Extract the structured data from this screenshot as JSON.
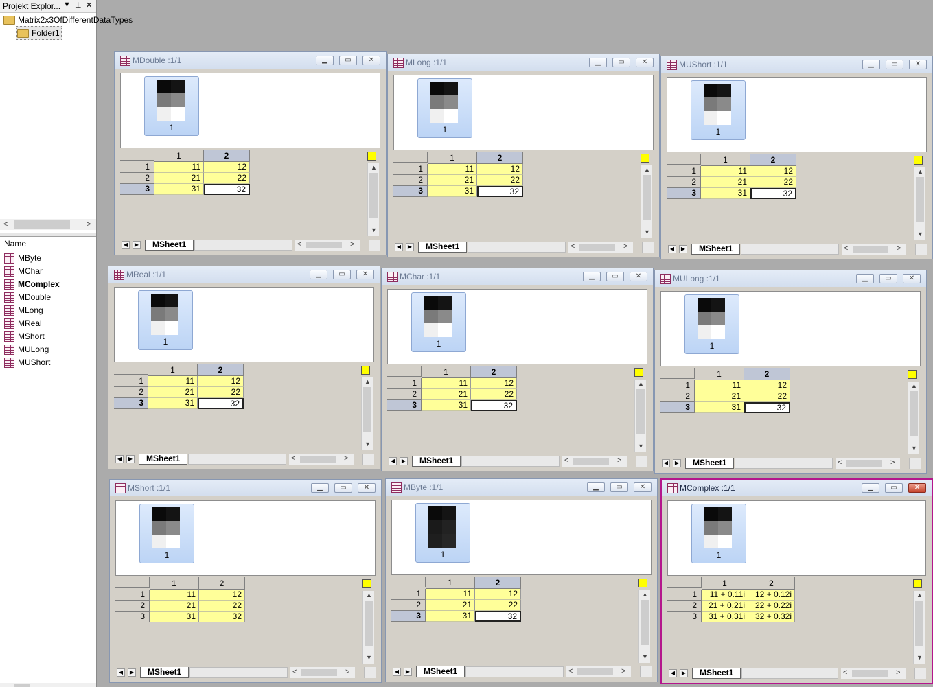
{
  "explorer": {
    "title": "Projekt Explor...",
    "pin": "▼",
    "dock": "⊥",
    "close": "✕",
    "tree": [
      {
        "label": "Matrix2x3OfDifferentDataTypes"
      },
      {
        "label": "Folder1"
      }
    ],
    "list_header": "Name",
    "items": [
      {
        "label": "MByte"
      },
      {
        "label": "MChar"
      },
      {
        "label": "MComplex"
      },
      {
        "label": "MDouble"
      },
      {
        "label": "MLong"
      },
      {
        "label": "MReal"
      },
      {
        "label": "MShort"
      },
      {
        "label": "MULong"
      },
      {
        "label": "MUShort"
      }
    ]
  },
  "colors": {
    "accent_active": "#b4168c",
    "cell_yellow": "#ffff99",
    "window_bg": "#d4d0c8"
  },
  "windows": [
    {
      "title": "MDouble :1/1",
      "thumb_label": "1",
      "columns": [
        "1",
        "2"
      ],
      "rows": [
        [
          "1",
          "11",
          "12"
        ],
        [
          "2",
          "21",
          "22"
        ],
        [
          "3",
          "31",
          "32"
        ]
      ],
      "sheet": "MSheet1"
    },
    {
      "title": "MLong :1/1",
      "thumb_label": "1",
      "columns": [
        "1",
        "2"
      ],
      "rows": [
        [
          "1",
          "11",
          "12"
        ],
        [
          "2",
          "21",
          "22"
        ],
        [
          "3",
          "31",
          "32"
        ]
      ],
      "sheet": "MSheet1"
    },
    {
      "title": "MUShort :1/1",
      "thumb_label": "1",
      "columns": [
        "1",
        "2"
      ],
      "rows": [
        [
          "1",
          "11",
          "12"
        ],
        [
          "2",
          "21",
          "22"
        ],
        [
          "3",
          "31",
          "32"
        ]
      ],
      "sheet": "MSheet1"
    },
    {
      "title": "MReal :1/1",
      "thumb_label": "1",
      "columns": [
        "1",
        "2"
      ],
      "rows": [
        [
          "1",
          "11",
          "12"
        ],
        [
          "2",
          "21",
          "22"
        ],
        [
          "3",
          "31",
          "32"
        ]
      ],
      "sheet": "MSheet1"
    },
    {
      "title": "MChar :1/1",
      "thumb_label": "1",
      "columns": [
        "1",
        "2"
      ],
      "rows": [
        [
          "1",
          "11",
          "12"
        ],
        [
          "2",
          "21",
          "22"
        ],
        [
          "3",
          "31",
          "32"
        ]
      ],
      "sheet": "MSheet1"
    },
    {
      "title": "MULong :1/1",
      "thumb_label": "1",
      "columns": [
        "1",
        "2"
      ],
      "rows": [
        [
          "1",
          "11",
          "12"
        ],
        [
          "2",
          "21",
          "22"
        ],
        [
          "3",
          "31",
          "32"
        ]
      ],
      "sheet": "MSheet1"
    },
    {
      "title": "MShort :1/1",
      "thumb_label": "1",
      "columns": [
        "1",
        "2"
      ],
      "rows": [
        [
          "1",
          "11",
          "12"
        ],
        [
          "2",
          "21",
          "22"
        ],
        [
          "3",
          "31",
          "32"
        ]
      ],
      "sheet": "MSheet1"
    },
    {
      "title": "MByte :1/1",
      "thumb_label": "1",
      "columns": [
        "1",
        "2"
      ],
      "rows": [
        [
          "1",
          "11",
          "12"
        ],
        [
          "2",
          "21",
          "22"
        ],
        [
          "3",
          "31",
          "32"
        ]
      ],
      "sheet": "MSheet1"
    },
    {
      "title": "MComplex :1/1",
      "thumb_label": "1",
      "columns": [
        "1",
        "2"
      ],
      "rows": [
        [
          "1",
          "11 + 0.11i",
          "12 + 0.12i"
        ],
        [
          "2",
          "21 + 0.21i",
          "22 + 0.22i"
        ],
        [
          "3",
          "31 + 0.31i",
          "32 + 0.32i"
        ]
      ],
      "sheet": "MSheet1"
    }
  ]
}
